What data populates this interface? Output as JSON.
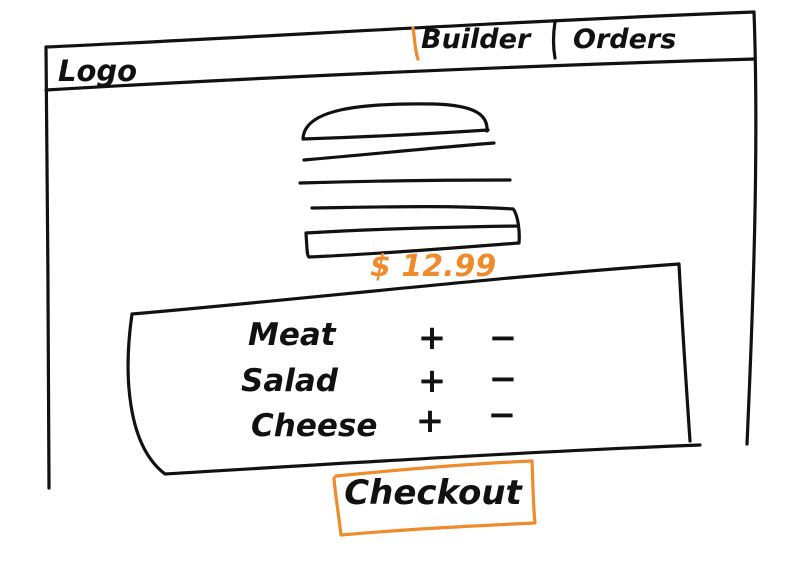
{
  "app": {
    "logo": "Logo"
  },
  "nav": {
    "items": [
      {
        "label": "Builder",
        "active": true
      },
      {
        "label": "Orders",
        "active": false
      }
    ]
  },
  "builder": {
    "price": "$ 12.99",
    "ingredients": [
      {
        "label": "Meat",
        "add": "+",
        "remove": "−"
      },
      {
        "label": "Salad",
        "add": "+",
        "remove": "−"
      },
      {
        "label": "Cheese",
        "add": "+",
        "remove": "−"
      }
    ]
  },
  "checkout": {
    "label": "Checkout"
  },
  "colors": {
    "ink": "#111111",
    "accent": "#ef8b2a",
    "background": "#ffffff"
  }
}
